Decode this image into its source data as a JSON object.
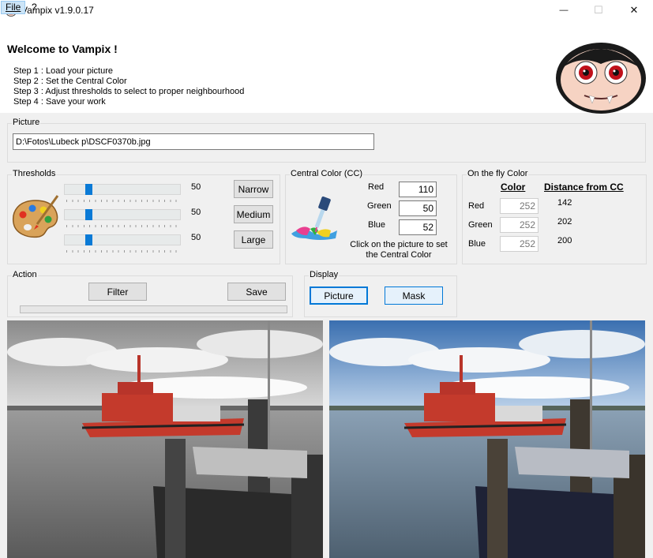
{
  "window": {
    "title": "Vampix v1.9.0.17",
    "minimize": "—",
    "maximize": "☐",
    "close": "✕"
  },
  "menu": {
    "file": "File",
    "help": "?"
  },
  "header": {
    "welcome": "Welcome to Vampix !",
    "steps": [
      "Step 1 : Load your picture",
      "Step 2 : Set the Central Color",
      "Step 3 : Adjust thresholds to select to proper neighbourhood",
      "Step 4 : Save your work"
    ]
  },
  "picture": {
    "label": "Picture",
    "path": "D:\\Fotos\\Lubeck p\\DSCF0370b.jpg"
  },
  "thresholds": {
    "label": "Thresholds",
    "values": [
      "50",
      "50",
      "50"
    ],
    "buttons": {
      "narrow": "Narrow",
      "medium": "Medium",
      "large": "Large"
    }
  },
  "central_color": {
    "label": "Central Color (CC)",
    "red_label": "Red",
    "green_label": "Green",
    "blue_label": "Blue",
    "red": "110",
    "green": "50",
    "blue": "52",
    "hint": "Click on the picture to set the Central Color"
  },
  "on_the_fly": {
    "label": "On the fly Color",
    "color_header": "Color",
    "distance_header": "Distance from CC",
    "rows": [
      {
        "name": "Red",
        "value": "252",
        "distance": "142"
      },
      {
        "name": "Green",
        "value": "252",
        "distance": "202"
      },
      {
        "name": "Blue",
        "value": "252",
        "distance": "200"
      }
    ]
  },
  "action": {
    "label": "Action",
    "filter": "Filter",
    "save": "Save"
  },
  "display": {
    "label": "Display",
    "picture": "Picture",
    "mask": "Mask"
  },
  "icons": {
    "app": "vampire-face-icon",
    "mascot": "vampire-mascot-icon",
    "palette": "paint-palette-icon",
    "dropper": "eyedropper-icon"
  }
}
